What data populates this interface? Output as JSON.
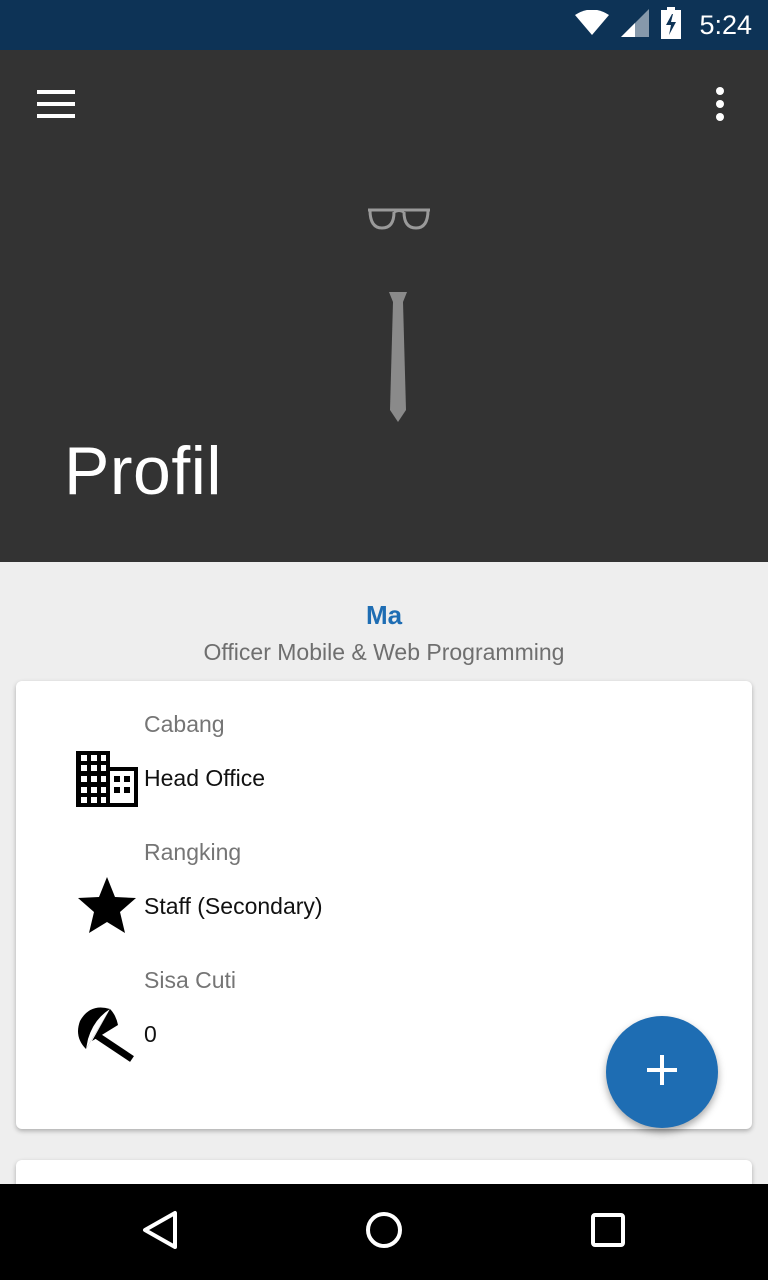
{
  "status_bar": {
    "time": "5:24",
    "icons": [
      "wifi-icon",
      "signal-icon",
      "battery-charging-icon"
    ],
    "background": "#0d3356"
  },
  "toolbar": {
    "menu_icon": "hamburger-menu-icon",
    "overflow_icon": "more-vertical-icon"
  },
  "header": {
    "title": "Profil",
    "illustration": [
      "glasses-icon",
      "tie-icon"
    ],
    "background": "#333333"
  },
  "profile": {
    "name": "Ma",
    "role": "Officer Mobile & Web Programming",
    "name_color": "#1e6db3"
  },
  "info_card": {
    "items": [
      {
        "label": "Cabang",
        "value": "Head Office",
        "icon": "building-icon"
      },
      {
        "label": "Rangking",
        "value": "Staff (Secondary)",
        "icon": "star-icon"
      },
      {
        "label": "Sisa Cuti",
        "value": "0",
        "icon": "beach-umbrella-icon"
      }
    ]
  },
  "fab": {
    "icon": "plus-icon",
    "color": "#1e6db3"
  },
  "nav_bar": {
    "buttons": [
      "back-icon",
      "home-icon",
      "recents-icon"
    ]
  }
}
